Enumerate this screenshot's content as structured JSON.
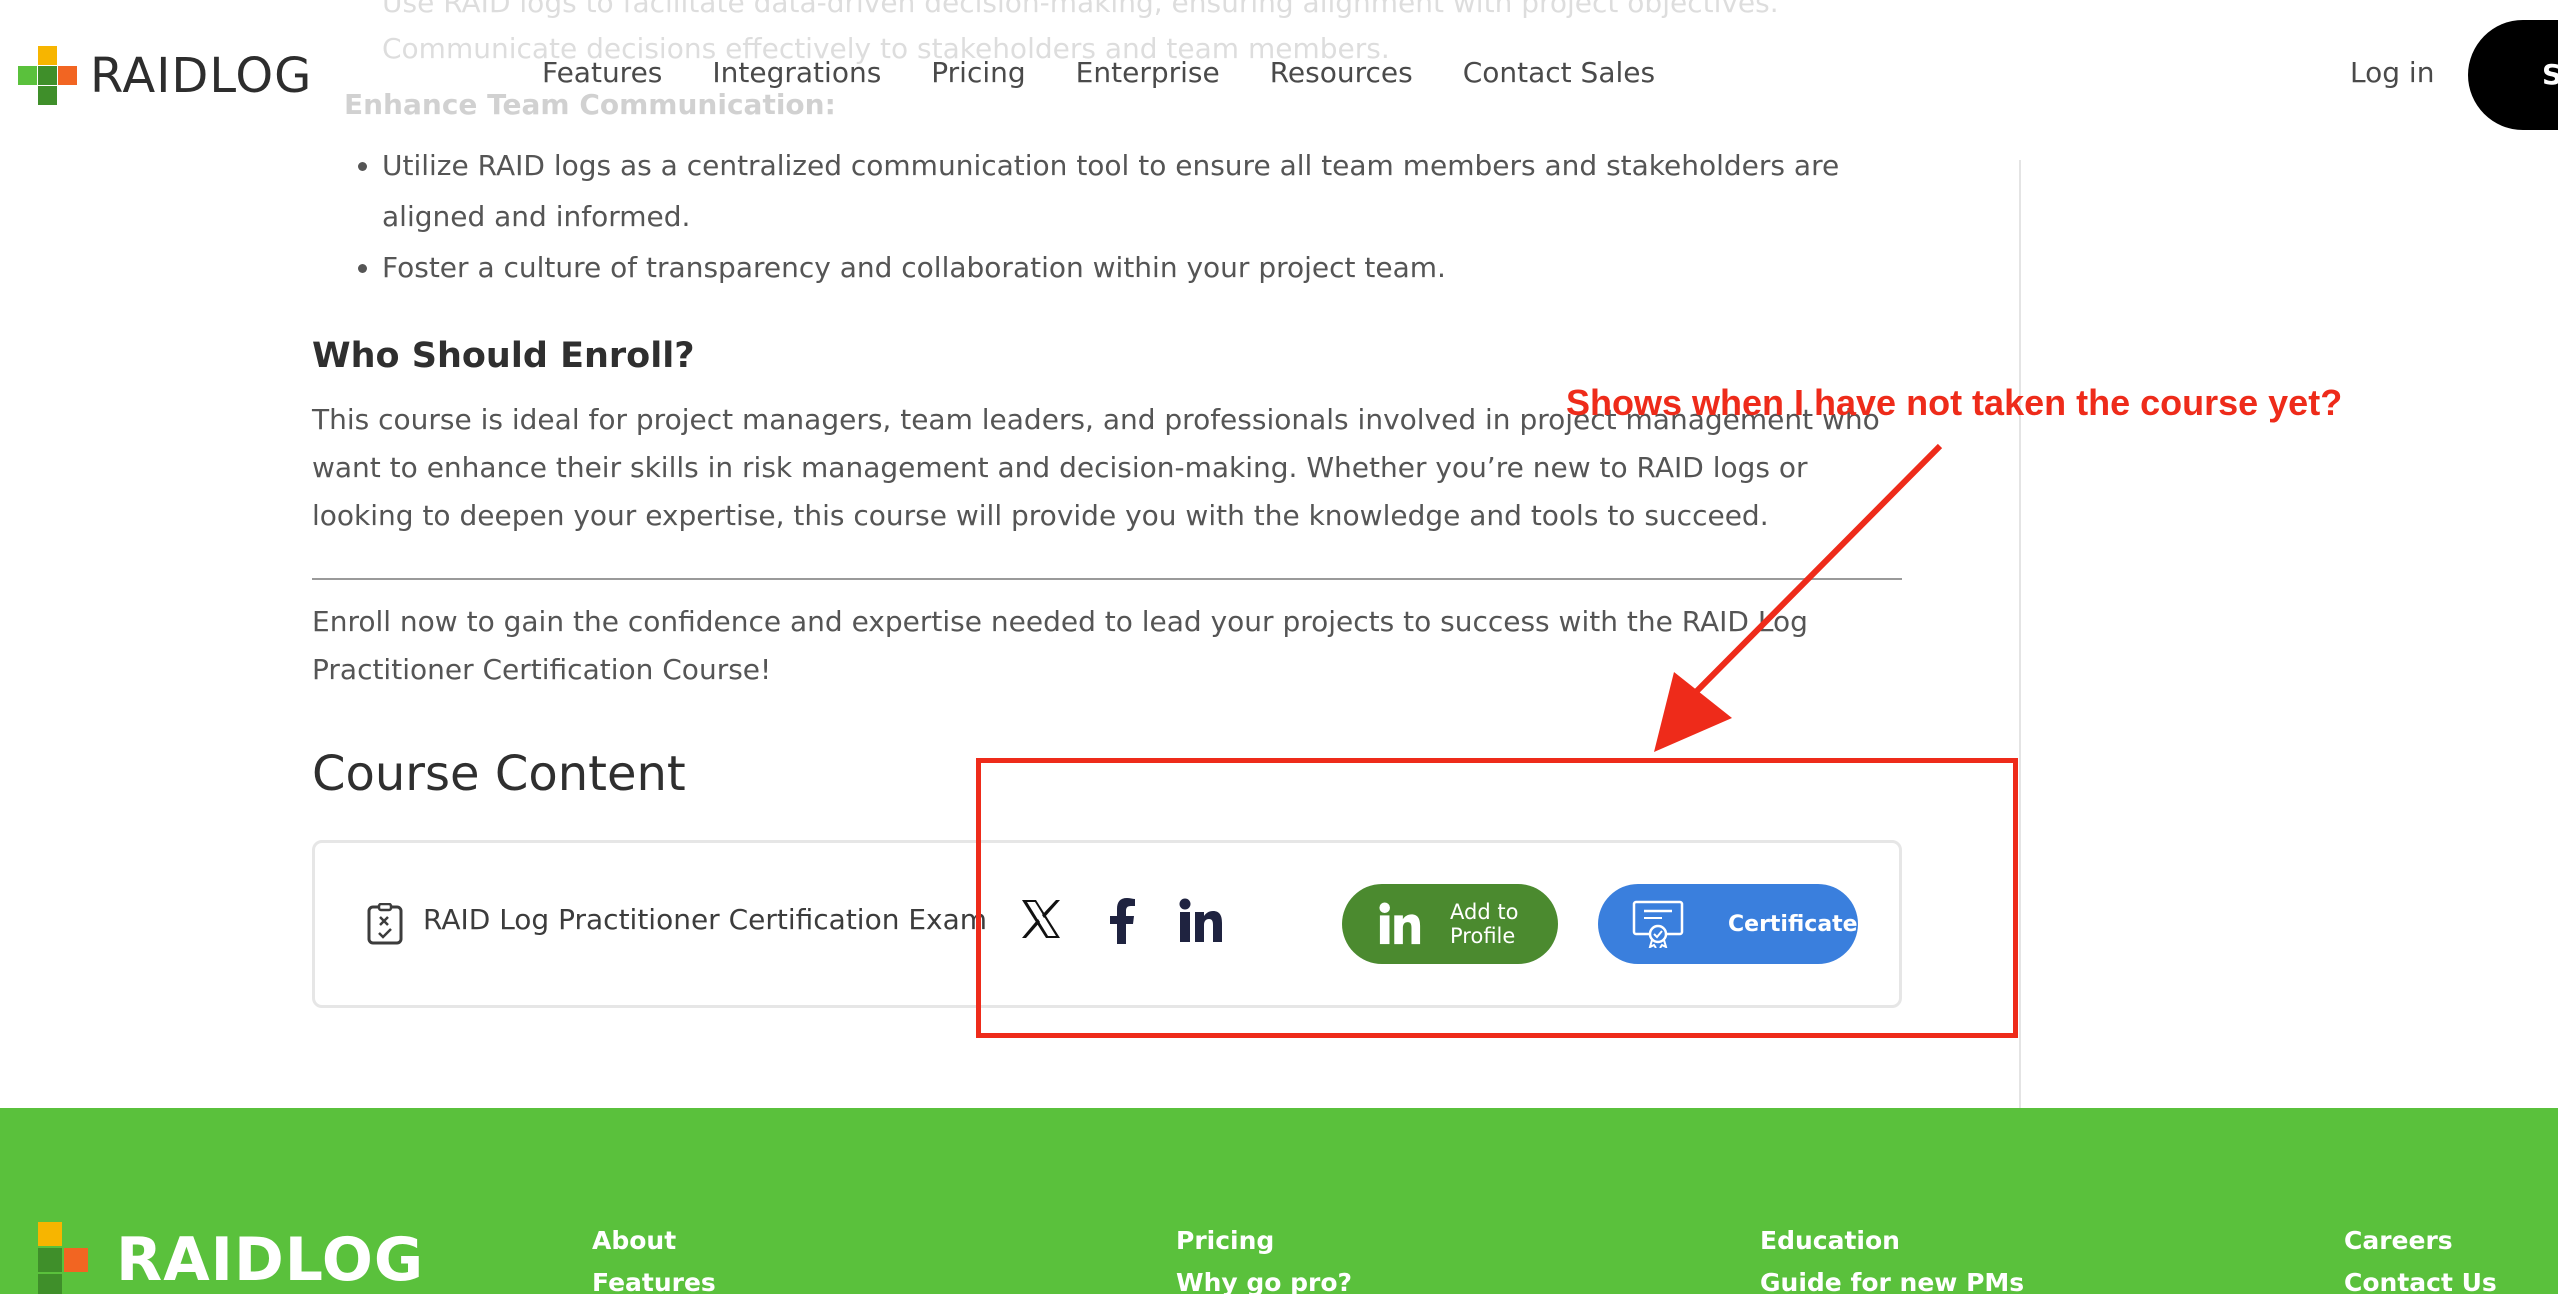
{
  "header": {
    "brand": "RAIDLOG",
    "nav": [
      "Features",
      "Integrations",
      "Pricing",
      "Enterprise",
      "Resources",
      "Contact Sales"
    ],
    "login": "Log in",
    "signup_partial": "S"
  },
  "behind_header": {
    "line1": "Use RAID logs to facilitate data-driven decision-making, ensuring alignment with project objectives.",
    "line2": "Communicate decisions effectively to stakeholders and team members.",
    "heading": "Enhance Team Communication:"
  },
  "content": {
    "bullets": [
      "Utilize RAID logs as a centralized communication tool to ensure all team members and stakeholders are aligned and informed.",
      "Foster a culture of transparency and collaboration within your project team."
    ],
    "enroll_heading": "Who Should Enroll?",
    "enroll_paragraph": "This course is ideal for project managers, team leaders, and professionals involved in project management who want to enhance their skills in risk management and decision-making. Whether you’re new to RAID logs or looking to deepen your expertise, this course will provide you with the knowledge and tools to succeed.",
    "final_paragraph": "Enroll now to gain the confidence and expertise needed to lead your projects to success with the RAID Log Practitioner Certification Course!",
    "course_heading": "Course Content",
    "exam_title": "RAID Log Practitioner Certification Exam",
    "add_to_profile": "Add to Profile",
    "certificate": "Certificate"
  },
  "annotation": {
    "text": "Shows when I have not taken the course yet?",
    "color": "#ee2b1a"
  },
  "footer": {
    "brand": "RAIDLOG",
    "col1": [
      "About",
      "Features"
    ],
    "col2": [
      "Pricing",
      "Why go pro?"
    ],
    "col3": [
      "Education",
      "Guide for new PMs"
    ],
    "col4": [
      "Careers",
      "Contact Us"
    ]
  },
  "colors": {
    "footer_green": "#5ac13c",
    "linkedin_button": "#4b8a2f",
    "certificate_button": "#3a7fdd",
    "logo_orange": "#f26522",
    "logo_yellow": "#f7b500",
    "logo_green": "#5ac13c",
    "logo_dark_green": "#3f8f2a"
  }
}
